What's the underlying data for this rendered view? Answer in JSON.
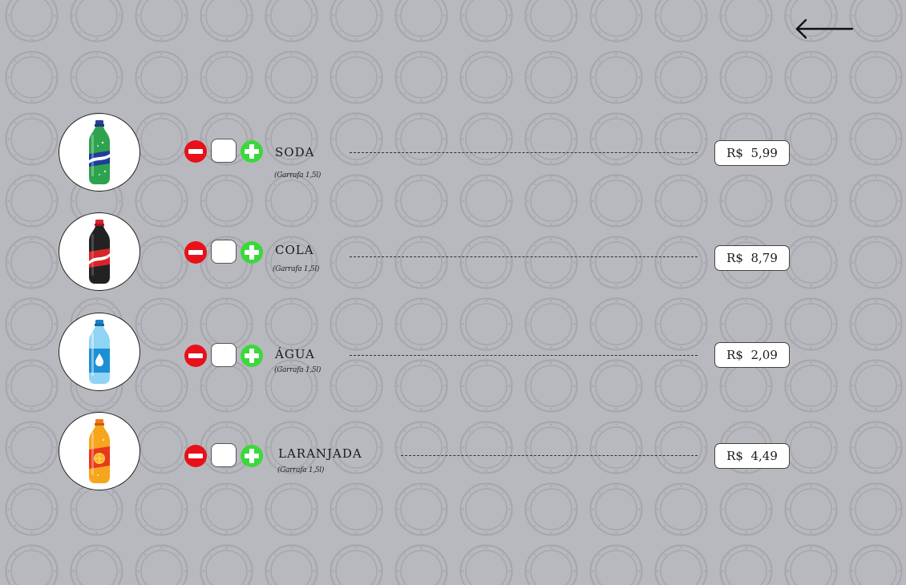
{
  "colors": {
    "background": "#b8b9be",
    "pattern_ring": "#a4a5aa",
    "minus_button": "#e8101a",
    "plus_button": "#3bd83b"
  },
  "back_icon": "left-arrow-icon",
  "qty_icons": {
    "minus": "minus-icon",
    "plus": "plus-icon"
  },
  "products": [
    {
      "name": "SODA",
      "size": "(Garrafa 1,5l)",
      "price": "R$  5,99",
      "qty": "",
      "bottle_icon": "soda-bottle-icon",
      "bottle_color": "#2fa24f"
    },
    {
      "name": "COLA",
      "size": "(Garrafa 1,5l)",
      "price": "R$  8,79",
      "qty": "",
      "bottle_icon": "cola-bottle-icon",
      "bottle_color": "#222222"
    },
    {
      "name": "ÁGUA",
      "size": "(Garrafa 1,5l)",
      "price": "R$  2,09",
      "qty": "",
      "bottle_icon": "water-bottle-icon",
      "bottle_color": "#4fb6e6"
    },
    {
      "name": "LARANJADA",
      "size": "(Garrafa 1,5l)",
      "price": "R$  4,49",
      "qty": "",
      "bottle_icon": "orange-soda-bottle-icon",
      "bottle_color": "#f39a1a"
    }
  ]
}
